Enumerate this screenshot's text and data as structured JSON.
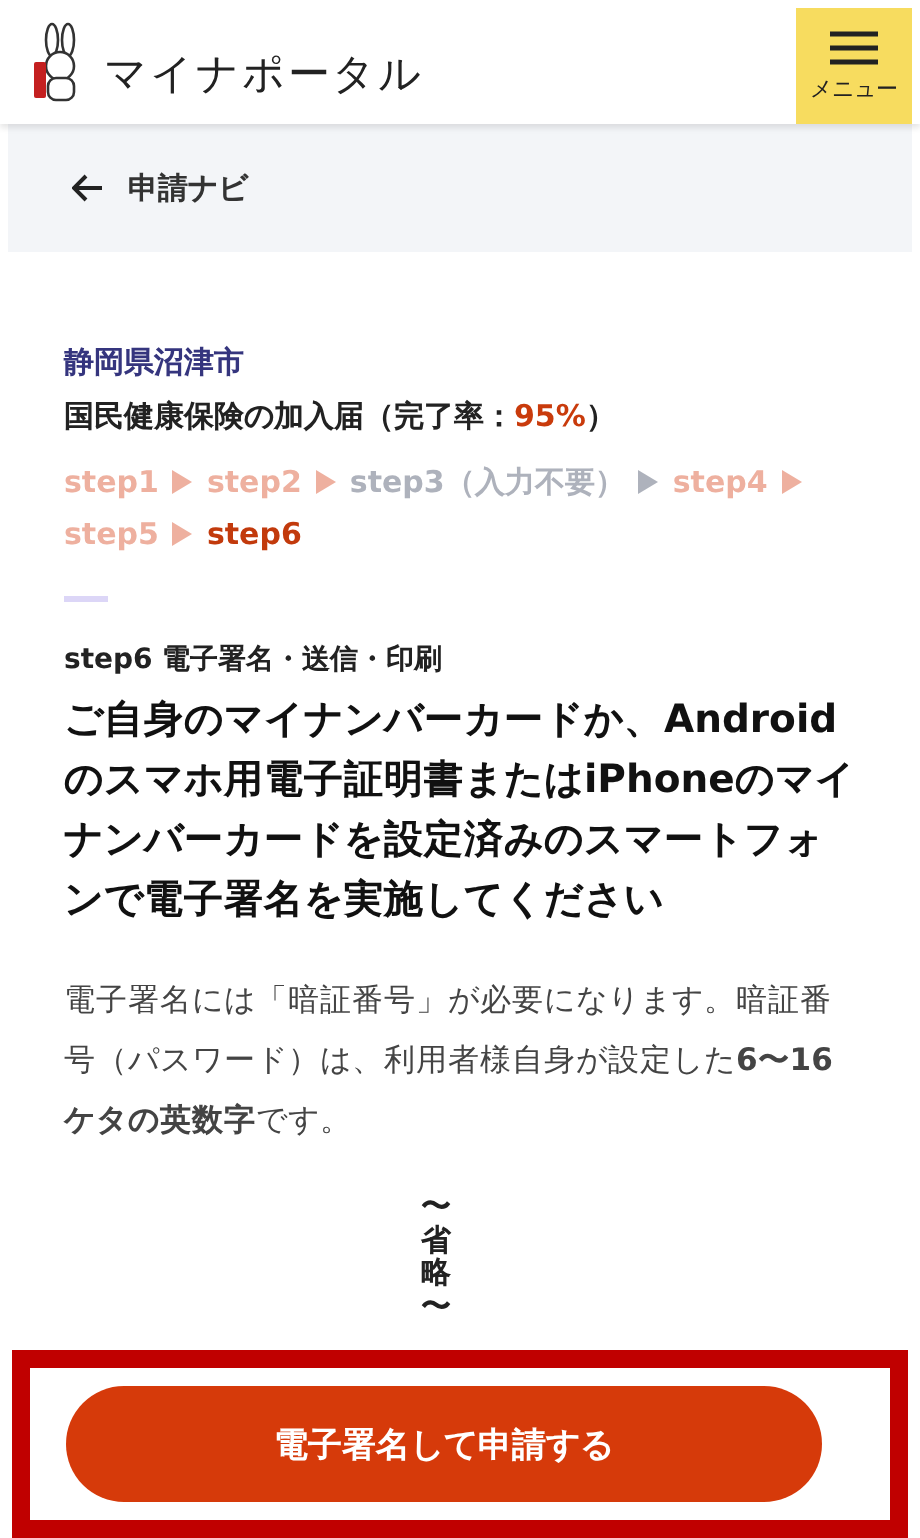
{
  "header": {
    "logo_text": "マイナポータル",
    "menu_label": "メニュー"
  },
  "nav": {
    "back_label": "申請ナビ"
  },
  "procedure": {
    "municipality": "静岡県沼津市",
    "form_name": "国民健康保険の加入届（完了率：",
    "completion_rate": "95%",
    "closing": "）"
  },
  "steps": [
    {
      "label": "step1",
      "completed": true,
      "selected": false
    },
    {
      "label": "step2",
      "completed": true,
      "selected": false
    },
    {
      "label": "step3（入力不要）",
      "completed": false,
      "selected": false
    },
    {
      "label": "step4",
      "completed": true,
      "selected": false
    },
    {
      "label": "step5",
      "completed": true,
      "selected": false
    },
    {
      "label": "step6",
      "completed": false,
      "selected": true
    }
  ],
  "section": {
    "step_title": "step6 電子署名・送信・印刷",
    "heading": "ご自身のマイナンバーカードか、Androidのスマホ用電子証明書またはiPhoneのマイナンバーカードを設定済みのスマートフォンで電子署名を実施してください",
    "body": "電子署名には「暗証番号」が必要になります。暗証番号（パスワード）は、利用者様自身が設定した**6〜16ケタの英数字**です。"
  },
  "omitted_note": "〜省略〜",
  "submit_button": "電子署名して申請する"
}
